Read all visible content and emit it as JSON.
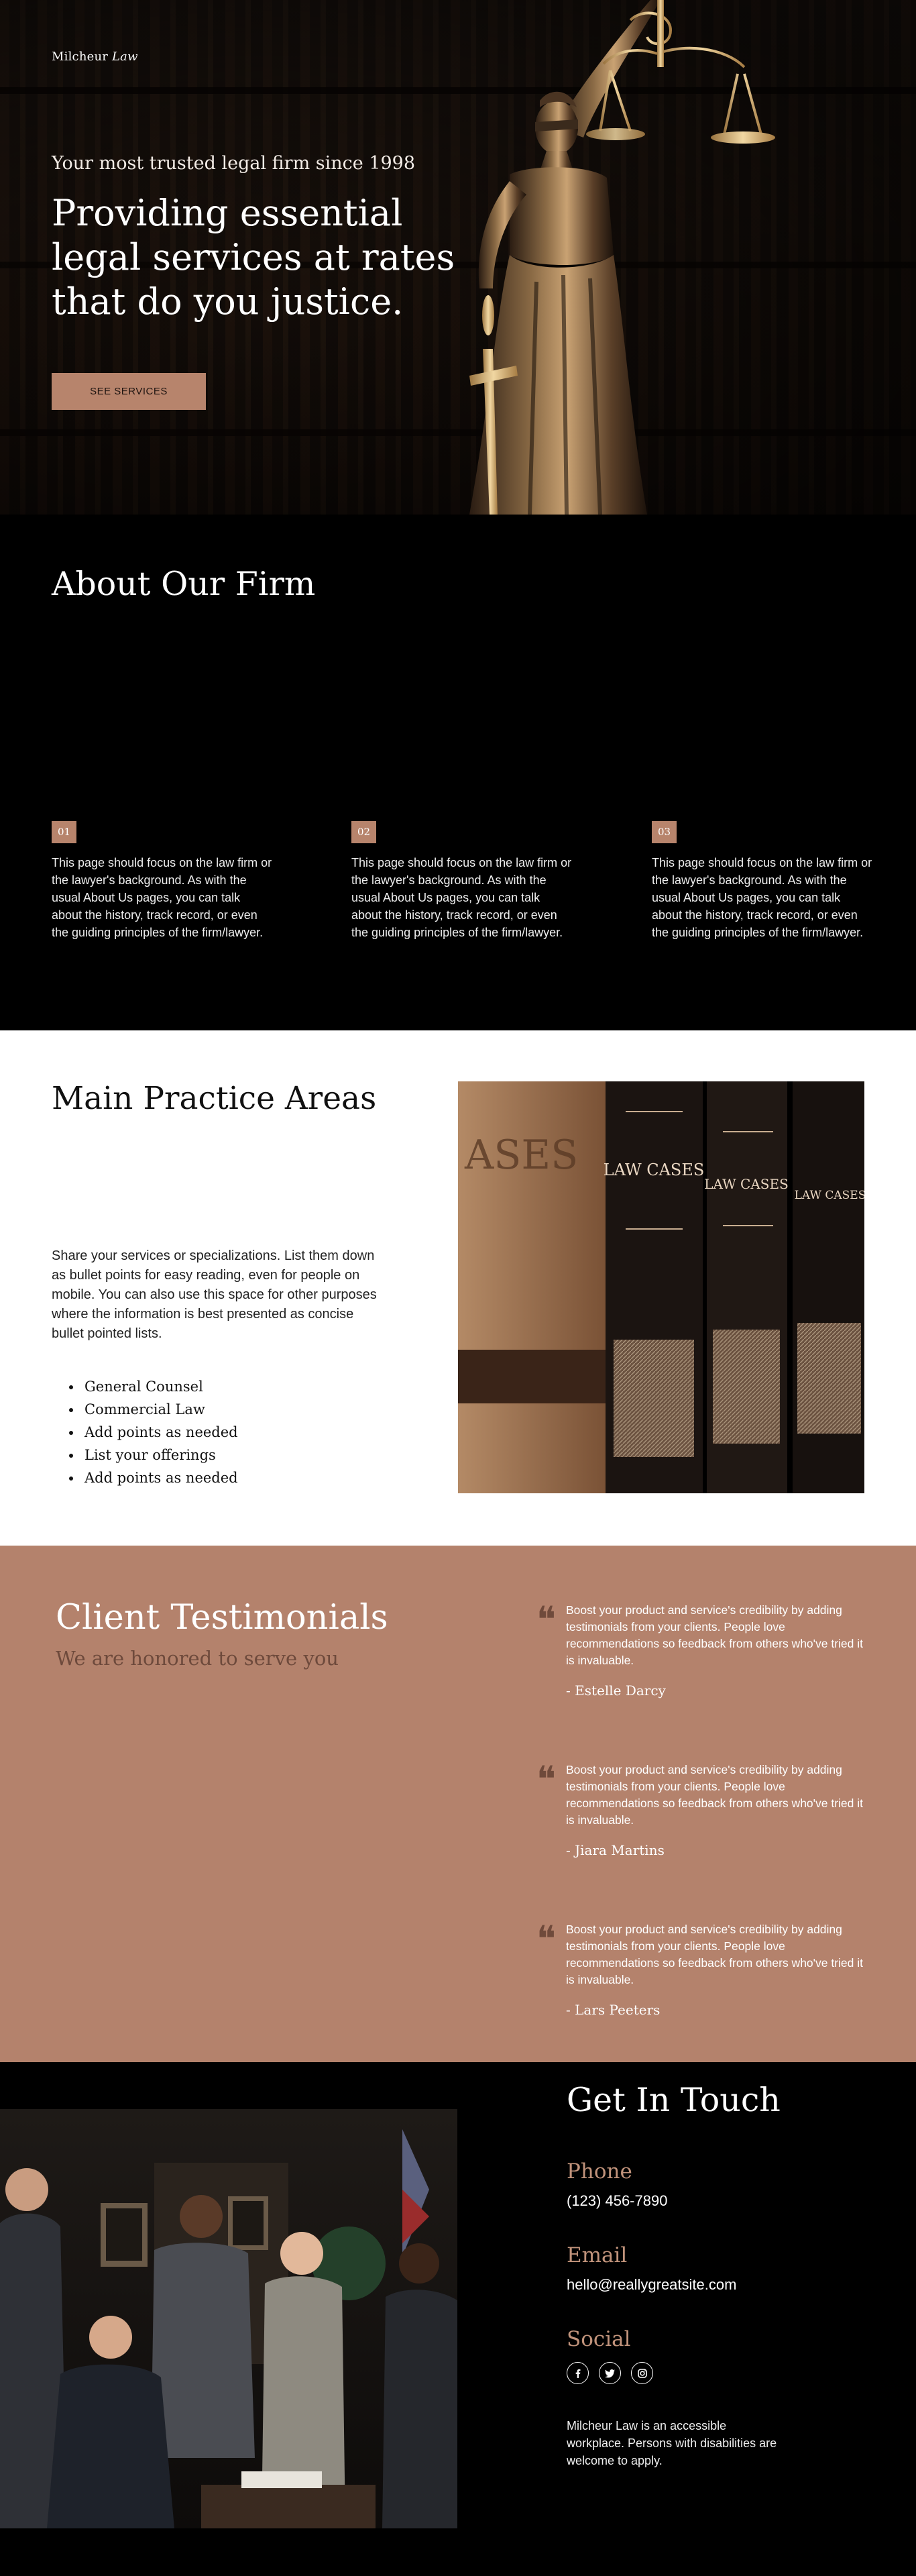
{
  "brand": {
    "name_plain": "Milcheur",
    "name_italic": "Law"
  },
  "hero": {
    "kicker": "Your most trusted legal firm since 1998",
    "title": "Providing essential legal services at rates that do you justice.",
    "cta_label": "SEE SERVICES",
    "image": "lady-justice-statue"
  },
  "about": {
    "title": "About Our Firm",
    "columns": [
      {
        "number": "01",
        "text": "This page should focus on the law firm or the lawyer's background. As with the usual About Us pages, you can talk about the history, track record, or even the guiding principles of the firm/lawyer."
      },
      {
        "number": "02",
        "text": "This page should focus on the law firm or the lawyer's background. As with the usual About Us pages, you can talk about the history, track record, or even the guiding principles of the firm/lawyer."
      },
      {
        "number": "03",
        "text": "This page should focus on the law firm or the lawyer's background. As with the usual About Us pages, you can talk about the history, track record, or even the guiding principles of the firm/lawyer."
      }
    ]
  },
  "practice": {
    "title": "Main Practice Areas",
    "description": "Share your services or specializations. List them down as bullet points for easy reading, even for people on mobile. You can also use this space for other purposes where the information is best presented as concise bullet pointed lists.",
    "items": [
      "General Counsel",
      "Commercial Law",
      "Add points as needed",
      "List your offerings",
      "Add points as needed"
    ],
    "image": "law-cases-books",
    "book_labels": [
      "LAW CASES",
      "LAW CASES",
      "LAW CASES"
    ]
  },
  "testimonials": {
    "title": "Client Testimonials",
    "subtitle": "We are honored to serve you",
    "items": [
      {
        "text": "Boost your product and service's credibility by adding testimonials from your clients. People love recommendations so feedback from others who've tried it is invaluable.",
        "author": "- Estelle Darcy"
      },
      {
        "text": "Boost your product and service's credibility by adding testimonials from your clients. People love recommendations so feedback from others who've tried it is invaluable.",
        "author": "- Jiara Martins"
      },
      {
        "text": "Boost your product and service's credibility by adding testimonials from your clients. People love recommendations so feedback from others who've tried it is invaluable.",
        "author": "- Lars Peeters"
      }
    ]
  },
  "contact": {
    "title": "Get In Touch",
    "phone_label": "Phone",
    "phone": "(123) 456-7890",
    "email_label": "Email",
    "email": "hello@reallygreatsite.com",
    "social_label": "Social",
    "socials": [
      "facebook-icon",
      "twitter-icon",
      "instagram-icon"
    ],
    "note": "Milcheur Law is an accessible workplace. Persons with disabilities are welcome to apply.",
    "image": "legal-team-photo"
  },
  "colors": {
    "accent": "#b7846c",
    "testimonial_bg": "#b4826c",
    "label": "#c1937b",
    "subtitle": "#6e4a3c"
  }
}
